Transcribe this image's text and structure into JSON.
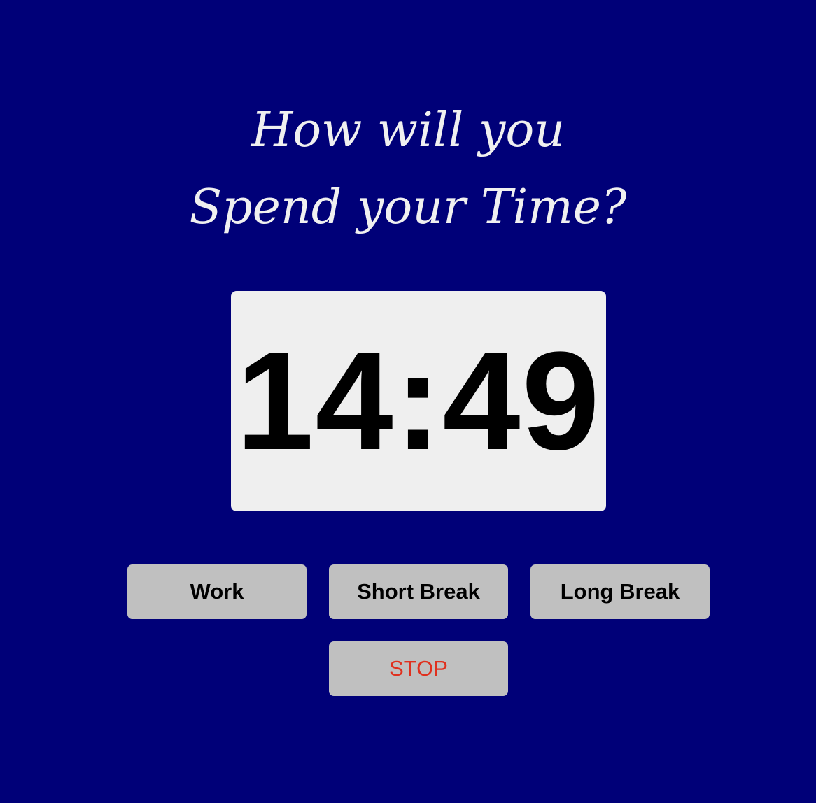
{
  "heading": {
    "line1": "How will you",
    "line2": "Spend your Time?"
  },
  "timer": {
    "display": "14:49"
  },
  "buttons": {
    "work": "Work",
    "short_break": "Short Break",
    "long_break": "Long Break",
    "stop": "STOP"
  },
  "colors": {
    "background": "#000078",
    "heading_text": "#f0f0f0",
    "timer_box": "#efefef",
    "button_bg": "#c0c0c0",
    "stop_text": "#e0301e"
  }
}
